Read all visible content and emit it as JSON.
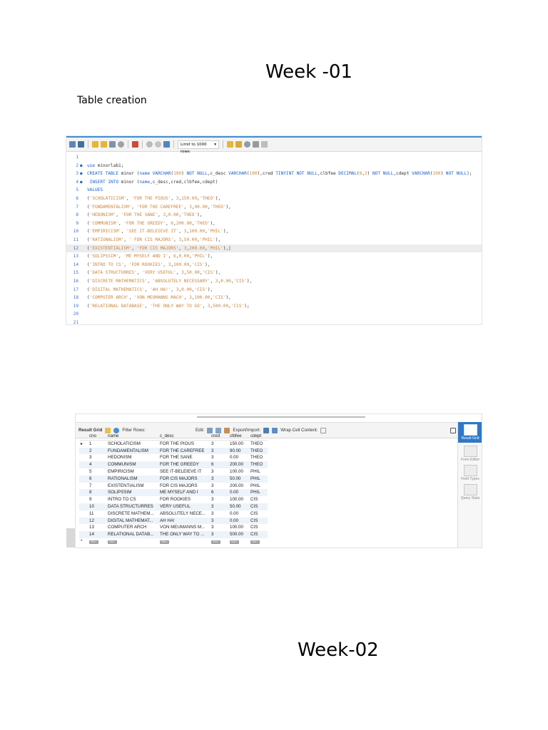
{
  "page": {
    "heading_week1": "Week -01",
    "subtitle": "Table creation",
    "heading_week2": "Week-02"
  },
  "editor": {
    "limit_label": "Limit to 1000 rows",
    "lines": [
      {
        "n": "1",
        "dot": "",
        "segs": [],
        "hl": false
      },
      {
        "n": "2",
        "dot": "●",
        "segs": [
          [
            "kw",
            "use "
          ],
          [
            "plain",
            "minorlab1;"
          ]
        ],
        "hl": false
      },
      {
        "n": "3",
        "dot": "●",
        "segs": [
          [
            "kw",
            "CREATE TABLE "
          ],
          [
            "plain",
            "minor ("
          ],
          [
            "kw",
            "name VARCHAR"
          ],
          [
            "plain",
            "("
          ],
          [
            "num",
            "100"
          ],
          [
            "plain",
            ") "
          ],
          [
            "kw",
            "NOT NULL"
          ],
          [
            "plain",
            ",c_desc "
          ],
          [
            "kw",
            "VARCHAR"
          ],
          [
            "plain",
            "("
          ],
          [
            "num",
            "100"
          ],
          [
            "plain",
            "),cred "
          ],
          [
            "kw",
            "TINYINT NOT NULL"
          ],
          [
            "plain",
            ",clbfee "
          ],
          [
            "kw",
            "DECIMAL"
          ],
          [
            "plain",
            "("
          ],
          [
            "num",
            "8"
          ],
          [
            "plain",
            ","
          ],
          [
            "num",
            "2"
          ],
          [
            "plain",
            ") "
          ],
          [
            "kw",
            "NOT NULL"
          ],
          [
            "plain",
            ",cdept "
          ],
          [
            "kw",
            "VARCHAR"
          ],
          [
            "plain",
            "("
          ],
          [
            "num",
            "100"
          ],
          [
            "plain",
            ") "
          ],
          [
            "kw",
            "NOT NULL"
          ],
          [
            "plain",
            ");"
          ]
        ],
        "hl": false
      },
      {
        "n": "4",
        "dot": "●",
        "segs": [
          [
            "kw",
            " INSERT INTO "
          ],
          [
            "plain",
            "minor ("
          ],
          [
            "kw",
            "name"
          ],
          [
            "plain",
            ",c_desc,cred,clbfee,cdept)"
          ]
        ],
        "hl": false
      },
      {
        "n": "5",
        "dot": "",
        "segs": [
          [
            "kw",
            "VALUES"
          ]
        ],
        "hl": false
      },
      {
        "n": "6",
        "dot": "",
        "segs": [
          [
            "plain",
            "("
          ],
          [
            "str",
            "'SCHOLATICISM'"
          ],
          [
            "plain",
            ", "
          ],
          [
            "str",
            "'FOR THE PIOUS'"
          ],
          [
            "plain",
            ", "
          ],
          [
            "num",
            "3"
          ],
          [
            "plain",
            ","
          ],
          [
            "num",
            "150.00"
          ],
          [
            "plain",
            ","
          ],
          [
            "str",
            "'THEO'"
          ],
          [
            "plain",
            "),"
          ]
        ],
        "hl": false
      },
      {
        "n": "7",
        "dot": "",
        "segs": [
          [
            "plain",
            "("
          ],
          [
            "str",
            "'FUNDAMENTALISM'"
          ],
          [
            "plain",
            ", "
          ],
          [
            "str",
            "'FOR THE CAREFREE'"
          ],
          [
            "plain",
            ", "
          ],
          [
            "num",
            "3"
          ],
          [
            "plain",
            ","
          ],
          [
            "num",
            "90.00"
          ],
          [
            "plain",
            ","
          ],
          [
            "str",
            "'THEO'"
          ],
          [
            "plain",
            "),"
          ]
        ],
        "hl": false
      },
      {
        "n": "8",
        "dot": "",
        "segs": [
          [
            "plain",
            "("
          ],
          [
            "str",
            "'HEDONISM'"
          ],
          [
            "plain",
            ", "
          ],
          [
            "str",
            "'FOR THE SANE'"
          ],
          [
            "plain",
            ", "
          ],
          [
            "num",
            "3"
          ],
          [
            "plain",
            ","
          ],
          [
            "num",
            "0.00"
          ],
          [
            "plain",
            ","
          ],
          [
            "str",
            "'THEO'"
          ],
          [
            "plain",
            "),"
          ]
        ],
        "hl": false
      },
      {
        "n": "9",
        "dot": "",
        "segs": [
          [
            "plain",
            "("
          ],
          [
            "str",
            "'COMMUNISM'"
          ],
          [
            "plain",
            ", "
          ],
          [
            "str",
            "'FOR THE GREEDY'"
          ],
          [
            "plain",
            ", "
          ],
          [
            "num",
            "6"
          ],
          [
            "plain",
            ","
          ],
          [
            "num",
            "200.00"
          ],
          [
            "plain",
            ","
          ],
          [
            "str",
            "'THEO'"
          ],
          [
            "plain",
            "),"
          ]
        ],
        "hl": false
      },
      {
        "n": "10",
        "dot": "",
        "segs": [
          [
            "plain",
            "("
          ],
          [
            "str",
            "'EMPIRICISM'"
          ],
          [
            "plain",
            ", "
          ],
          [
            "str",
            "'SEE IT-BELEIEVE IT'"
          ],
          [
            "plain",
            ", "
          ],
          [
            "num",
            "3"
          ],
          [
            "plain",
            ","
          ],
          [
            "num",
            "100.00"
          ],
          [
            "plain",
            ","
          ],
          [
            "str",
            "'PHIL'"
          ],
          [
            "plain",
            "),"
          ]
        ],
        "hl": false
      },
      {
        "n": "11",
        "dot": "",
        "segs": [
          [
            "plain",
            "("
          ],
          [
            "str",
            "'RATIONALISM'"
          ],
          [
            "plain",
            ", "
          ],
          [
            "str",
            "' FOR CIS MAJORS'"
          ],
          [
            "plain",
            ", "
          ],
          [
            "num",
            "3"
          ],
          [
            "plain",
            ","
          ],
          [
            "num",
            "50.00"
          ],
          [
            "plain",
            ","
          ],
          [
            "str",
            "'PHIL'"
          ],
          [
            "plain",
            "),"
          ]
        ],
        "hl": false
      },
      {
        "n": "12",
        "dot": "",
        "segs": [
          [
            "plain",
            "("
          ],
          [
            "str",
            "'EXISTENTIALISM'"
          ],
          [
            "plain",
            ", "
          ],
          [
            "str",
            "'FOR CIS MAJORS'"
          ],
          [
            "plain",
            ", "
          ],
          [
            "num",
            "3"
          ],
          [
            "plain",
            ","
          ],
          [
            "num",
            "200.00"
          ],
          [
            "plain",
            ","
          ],
          [
            "str",
            "'PHIL'"
          ],
          [
            "plain",
            "),|"
          ]
        ],
        "hl": true
      },
      {
        "n": "13",
        "dot": "",
        "segs": [
          [
            "plain",
            "("
          ],
          [
            "str",
            "'SOLIPSSIM'"
          ],
          [
            "plain",
            ", "
          ],
          [
            "str",
            "'ME MYSELF AND I'"
          ],
          [
            "plain",
            ", "
          ],
          [
            "num",
            "6"
          ],
          [
            "plain",
            ","
          ],
          [
            "num",
            "0.00"
          ],
          [
            "plain",
            ","
          ],
          [
            "str",
            "'PHIL'"
          ],
          [
            "plain",
            "),"
          ]
        ],
        "hl": false
      },
      {
        "n": "14",
        "dot": "",
        "segs": [
          [
            "plain",
            "("
          ],
          [
            "str",
            "'INTRO TO CS'"
          ],
          [
            "plain",
            ", "
          ],
          [
            "str",
            "'FOR ROOKIES'"
          ],
          [
            "plain",
            ", "
          ],
          [
            "num",
            "3"
          ],
          [
            "plain",
            ","
          ],
          [
            "num",
            "100.00"
          ],
          [
            "plain",
            ","
          ],
          [
            "str",
            "'CIS'"
          ],
          [
            "plain",
            "),"
          ]
        ],
        "hl": false
      },
      {
        "n": "15",
        "dot": "",
        "segs": [
          [
            "plain",
            "("
          ],
          [
            "str",
            "'DATA STRUCTURRES'"
          ],
          [
            "plain",
            ", "
          ],
          [
            "str",
            "'VERY USEFUL'"
          ],
          [
            "plain",
            ", "
          ],
          [
            "num",
            "3"
          ],
          [
            "plain",
            ","
          ],
          [
            "num",
            "50.00"
          ],
          [
            "plain",
            ","
          ],
          [
            "str",
            "'CIS'"
          ],
          [
            "plain",
            "),"
          ]
        ],
        "hl": false
      },
      {
        "n": "16",
        "dot": "",
        "segs": [
          [
            "plain",
            "("
          ],
          [
            "str",
            "'DISCRETE MATHEMATICS'"
          ],
          [
            "plain",
            ", "
          ],
          [
            "str",
            "'ABSOLUTELY NECESSARY'"
          ],
          [
            "plain",
            ", "
          ],
          [
            "num",
            "3"
          ],
          [
            "plain",
            ","
          ],
          [
            "num",
            "0.00"
          ],
          [
            "plain",
            ","
          ],
          [
            "str",
            "'CIS'"
          ],
          [
            "plain",
            "),"
          ]
        ],
        "hl": false
      },
      {
        "n": "17",
        "dot": "",
        "segs": [
          [
            "plain",
            "("
          ],
          [
            "str",
            "'DIGITAL MATHEMATICS'"
          ],
          [
            "plain",
            ", "
          ],
          [
            "str",
            "'AH HA!'"
          ],
          [
            "plain",
            ", "
          ],
          [
            "num",
            "3"
          ],
          [
            "plain",
            ","
          ],
          [
            "num",
            "0.00"
          ],
          [
            "plain",
            ","
          ],
          [
            "str",
            "'CIS'"
          ],
          [
            "plain",
            "),"
          ]
        ],
        "hl": false
      },
      {
        "n": "18",
        "dot": "",
        "segs": [
          [
            "plain",
            "("
          ],
          [
            "str",
            "'COMPUTER ARCH'"
          ],
          [
            "plain",
            ", "
          ],
          [
            "str",
            "'VON MEUMANNS MACH'"
          ],
          [
            "plain",
            ", "
          ],
          [
            "num",
            "3"
          ],
          [
            "plain",
            ","
          ],
          [
            "num",
            "100.00"
          ],
          [
            "plain",
            ","
          ],
          [
            "str",
            "'CIS'"
          ],
          [
            "plain",
            "),"
          ]
        ],
        "hl": false
      },
      {
        "n": "19",
        "dot": "",
        "segs": [
          [
            "plain",
            "("
          ],
          [
            "str",
            "'RELATIONAL DATABASE'"
          ],
          [
            "plain",
            ", "
          ],
          [
            "str",
            "'THE ONLY WAY TO GO'"
          ],
          [
            "plain",
            ", "
          ],
          [
            "num",
            "3"
          ],
          [
            "plain",
            ","
          ],
          [
            "num",
            "500.00"
          ],
          [
            "plain",
            ","
          ],
          [
            "str",
            "'CIS'"
          ],
          [
            "plain",
            ");"
          ]
        ],
        "hl": false
      },
      {
        "n": "20",
        "dot": "",
        "segs": [],
        "hl": false
      },
      {
        "n": "21",
        "dot": "",
        "segs": [],
        "hl": false
      }
    ]
  },
  "result": {
    "tab_label": "Result Grid",
    "filter_label": "Filter Rows:",
    "edit_label": "Edit:",
    "export_label": "Export/Import:",
    "wrap_label": "Wrap Cell Content:",
    "columns": [
      "cno",
      "name",
      "c_desc",
      "cred",
      "clbfee",
      "cdept"
    ],
    "rows": [
      [
        "1",
        "SCHOLATICISM",
        "FOR THE PIOUS",
        "3",
        "150.00",
        "THEO"
      ],
      [
        "2",
        "FUNDAMENTALISM",
        "FOR THE CAREFREE",
        "3",
        "90.00",
        "THEO"
      ],
      [
        "3",
        "HEDONISM",
        "FOR THE SANE",
        "3",
        "0.00",
        "THEO"
      ],
      [
        "4",
        "COMMUNISM",
        "FOR THE GREEDY",
        "6",
        "200.00",
        "THEO"
      ],
      [
        "5",
        "EMPIRICISM",
        "SEE IT-BELEIEVE IT",
        "3",
        "100.00",
        "PHIL"
      ],
      [
        "6",
        "RATIONALISM",
        " FOR CIS MAJORS",
        "3",
        "50.00",
        "PHIL"
      ],
      [
        "7",
        "EXISTENTIALISM",
        "FOR CIS MAJORS",
        "3",
        "200.00",
        "PHIL"
      ],
      [
        "8",
        "SOLIPSSIM",
        "ME MYSELF AND I",
        "6",
        "0.00",
        "PHIL"
      ],
      [
        "9",
        "INTRO TO CS",
        "FOR ROOKIES",
        "3",
        "100.00",
        "CIS"
      ],
      [
        "10",
        "DATA STRUCTURRES",
        "VERY USEFUL",
        "3",
        "50.00",
        "CIS"
      ],
      [
        "11",
        "DISCRETE MATHEM...",
        "ABSOLUTELY NECE...",
        "3",
        "0.00",
        "CIS"
      ],
      [
        "12",
        "DIGITAL MATHEMAT...",
        "AH HA!",
        "3",
        "0.00",
        "CIS"
      ],
      [
        "13",
        "COMPUTER ARCH",
        "VON MEUMANNS M...",
        "3",
        "100.00",
        "CIS"
      ],
      [
        "14",
        "RELATIONAL DATAB...",
        "THE ONLY WAY TO ...",
        "3",
        "500.00",
        "CIS"
      ]
    ],
    "current_row_marker": "▸",
    "new_row_marker": "*",
    "null_label": "NULL",
    "side_buttons": [
      {
        "label": "Result Grid",
        "active": true
      },
      {
        "label": "Form Editor",
        "active": false
      },
      {
        "label": "Field Types",
        "active": false
      },
      {
        "label": "Query Stats",
        "active": false
      }
    ]
  }
}
